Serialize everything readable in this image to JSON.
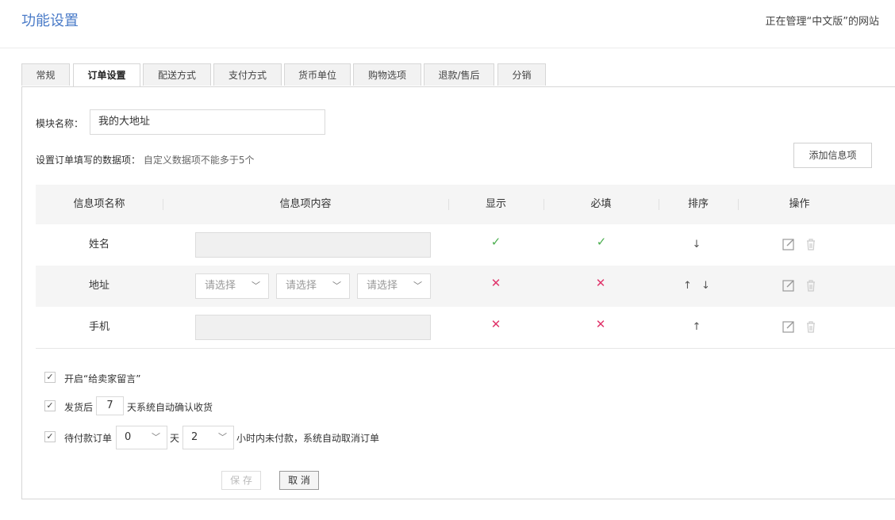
{
  "header": {
    "title": "功能设置",
    "site_info": "正在管理“中文版”的网站"
  },
  "tabs": [
    {
      "label": "常规"
    },
    {
      "label": "订单设置"
    },
    {
      "label": "配送方式"
    },
    {
      "label": "支付方式"
    },
    {
      "label": "货币单位"
    },
    {
      "label": "购物选项"
    },
    {
      "label": "退款/售后"
    },
    {
      "label": "分销"
    }
  ],
  "form": {
    "module_name_label": "模块名称：",
    "module_name_value": "我的大地址",
    "data_items_label": "设置订单填写的数据项：",
    "data_items_hint": "自定义数据项不能多于5个",
    "add_button": "添加信息项"
  },
  "table": {
    "headers": [
      "信息项名称",
      "信息项内容",
      "显示",
      "必填",
      "排序",
      "操作"
    ],
    "rows": [
      {
        "name": "姓名",
        "show": "✓",
        "required": "✓",
        "sort": "↓"
      },
      {
        "name": "地址",
        "show": "✕",
        "required": "✕",
        "sort": "↑ ↓",
        "selects": [
          "请选择",
          "请选择",
          "请选择"
        ]
      },
      {
        "name": "手机",
        "show": "✕",
        "required": "✕",
        "sort": "↑"
      }
    ]
  },
  "options": {
    "opt1": {
      "checked": "✓",
      "label": "开启“给卖家留言”"
    },
    "opt2": {
      "checked": "✓",
      "label_before": "发货后",
      "value": "7",
      "label_after": "天系统自动确认收货"
    },
    "opt3": {
      "checked": "✓",
      "label_before": "待付款订单",
      "days": "0",
      "days_unit": "天",
      "hours": "2",
      "label_after": "小时内未付款，系统自动取消订单"
    }
  },
  "actions": {
    "save": "保 存",
    "cancel": "取 消"
  },
  "colors": {
    "accent": "#4a7bc8",
    "ok": "#4caf50",
    "no": "#e0356b"
  },
  "icons": {
    "edit": "edit-icon",
    "delete": "trash-icon",
    "chevron": "chevron-down-icon",
    "check": "check-icon"
  }
}
